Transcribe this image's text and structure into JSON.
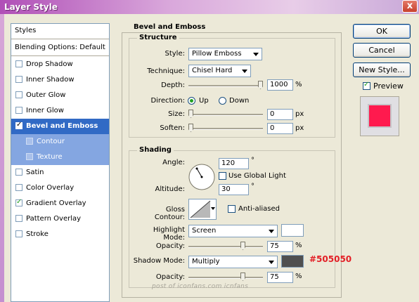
{
  "window": {
    "title": "Layer Style",
    "close_glyph": "x"
  },
  "styles_list": {
    "header": "Styles",
    "blending": "Blending Options: Default",
    "items": [
      {
        "label": "Drop Shadow",
        "checked": false
      },
      {
        "label": "Inner Shadow",
        "checked": false
      },
      {
        "label": "Outer Glow",
        "checked": false
      },
      {
        "label": "Inner Glow",
        "checked": false
      },
      {
        "label": "Bevel and Emboss",
        "checked": true,
        "selected": true
      },
      {
        "label": "Contour",
        "checked": false,
        "sub": true
      },
      {
        "label": "Texture",
        "checked": false,
        "sub": true
      },
      {
        "label": "Satin",
        "checked": false
      },
      {
        "label": "Color Overlay",
        "checked": false
      },
      {
        "label": "Gradient Overlay",
        "checked": true
      },
      {
        "label": "Pattern Overlay",
        "checked": false
      },
      {
        "label": "Stroke",
        "checked": false
      }
    ]
  },
  "bevel": {
    "title": "Bevel and Emboss",
    "structure": {
      "label": "Structure",
      "style_label": "Style:",
      "style_value": "Pillow Emboss",
      "technique_label": "Technique:",
      "technique_value": "Chisel Hard",
      "depth_label": "Depth:",
      "depth_value": "1000",
      "depth_unit": "%",
      "depth_fraction": 1.0,
      "direction_label": "Direction:",
      "dir_up": "Up",
      "dir_down": "Down",
      "direction_selected": "Up",
      "size_label": "Size:",
      "size_value": "0",
      "size_unit": "px",
      "size_fraction": 0.0,
      "soften_label": "Soften:",
      "soften_value": "0",
      "soften_unit": "px",
      "soften_fraction": 0.0
    },
    "shading": {
      "label": "Shading",
      "angle_label": "Angle:",
      "angle_value": "120",
      "angle_unit": "°",
      "global_light_label": "Use Global Light",
      "global_light_checked": false,
      "altitude_label": "Altitude:",
      "altitude_value": "30",
      "altitude_unit": "°",
      "gloss_label": "Gloss Contour:",
      "antialiased_label": "Anti-aliased",
      "antialiased_checked": false,
      "highlight_mode_label": "Highlight Mode:",
      "highlight_mode_value": "Screen",
      "highlight_color": "#ffffff",
      "highlight_opacity_label": "Opacity:",
      "highlight_opacity_value": "75",
      "highlight_opacity_unit": "%",
      "highlight_opacity_fraction": 0.75,
      "shadow_mode_label": "Shadow Mode:",
      "shadow_mode_value": "Multiply",
      "shadow_color": "#505050",
      "shadow_opacity_label": "Opacity:",
      "shadow_opacity_value": "75",
      "shadow_opacity_unit": "%",
      "shadow_opacity_fraction": 0.75
    }
  },
  "buttons": {
    "ok": "OK",
    "cancel": "Cancel",
    "new_style": "New Style..."
  },
  "preview": {
    "label": "Preview",
    "checked": true,
    "swatch_color": "#ff1a4e"
  },
  "annotation": "#505050",
  "watermark": "post of iconfans.com  icnfans"
}
